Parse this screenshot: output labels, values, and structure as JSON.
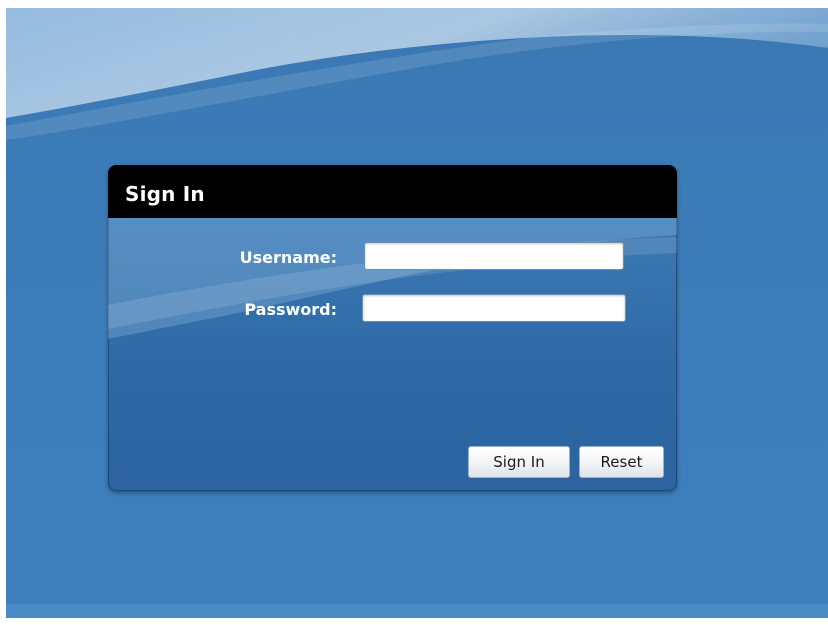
{
  "signin": {
    "title": "Sign In",
    "username_label": "Username:",
    "username_value": "",
    "password_label": "Password:",
    "password_value": "",
    "submit_label": "Sign In",
    "reset_label": "Reset"
  },
  "colors": {
    "background": "#3c7db9",
    "header": "#000000",
    "label_text": "#ffffff"
  }
}
